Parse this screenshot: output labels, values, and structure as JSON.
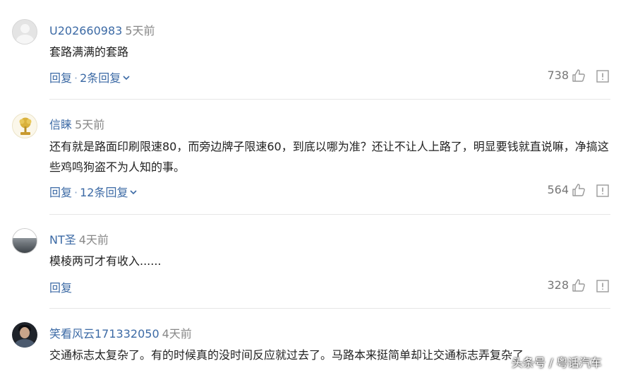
{
  "comments": [
    {
      "username": "U202660983",
      "time": "5天前",
      "text": "套路满满的套路",
      "reply": "回复",
      "reply_count": "2条回复",
      "likes": "738"
    },
    {
      "username": "信睐",
      "time": "5天前",
      "text": "还有就是路面印刷限速80，而旁边牌子限速60，到底以哪为准？还让不让人上路了，明显要钱就直说嘛，净搞这些鸡鸣狗盗不为人知的事。",
      "reply": "回复",
      "reply_count": "12条回复",
      "likes": "564"
    },
    {
      "username": "NT圣",
      "time": "4天前",
      "text": "模棱两可才有收入......",
      "reply": "回复",
      "likes": "328"
    },
    {
      "username": "笑看风云171332050",
      "time": "4天前",
      "text": "交通标志太复杂了。有的时候真的没时间反应就过去了。马路本来挺简单却让交通标志弄复杂了"
    }
  ],
  "reply_separator": "·",
  "icons": [
    "like-icon",
    "report-icon",
    "chevron-down-icon"
  ],
  "watermark": "头条号 / 粤话汽车",
  "colors": {
    "link": "#3c6aa5",
    "muted": "#888888",
    "text": "#222222"
  }
}
